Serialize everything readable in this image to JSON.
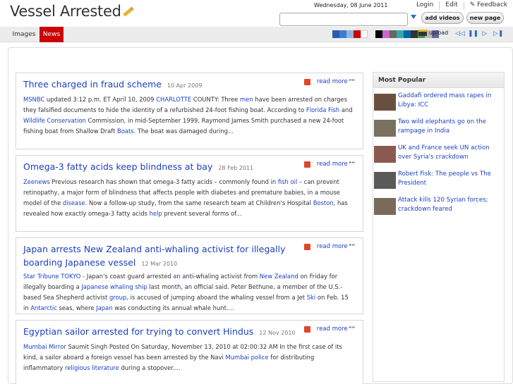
{
  "header": {
    "logo": "Vessel Arrested",
    "date": "Wednesday, 08 June 2011",
    "links": [
      "Login",
      "Edit",
      "Feedback"
    ],
    "search_placeholder": "",
    "add_videos": "add videos",
    "new_page": "new page"
  },
  "nav": {
    "tabs": [
      "Images",
      "News"
    ],
    "active_tab": "News",
    "upload": "upload"
  },
  "colors": {
    "accent": "#cc0000",
    "link": "#1a3fbf",
    "swatches": [
      "#2a5caa",
      "#3a7bd5",
      "#8fb4e0",
      "#cc0000",
      "#ffffff",
      "#000000",
      "#cc66cc",
      "#666666",
      "#33aaaa",
      "#0066aa",
      "#333333",
      "#449944",
      "#bbbbbb",
      "#666699"
    ]
  },
  "articles": [
    {
      "title": "Three charged in fraud scheme",
      "date": "10 Apr 2009",
      "source": "MSNBC",
      "read_more": "read more",
      "body": [
        {
          "t": " updated 3:12 p.m. ET April 10, 2009 "
        },
        {
          "t": "CHARLOTTE",
          "link": true
        },
        {
          "t": " COUNTY: Three "
        },
        {
          "t": "men",
          "link": true
        },
        {
          "t": " have been arrested on charges they falsified documents to hide the identity of a refurbished 24-foot fishing boat. According to "
        },
        {
          "t": "Florida Fish",
          "link": true
        },
        {
          "t": " and "
        },
        {
          "t": "Wildlife Conservation",
          "link": true
        },
        {
          "t": " Commission, in mid-September 1999, Raymond James Smith purchased a new 24-foot fishing boat from Shallow Draft "
        },
        {
          "t": "Boats",
          "link": true
        },
        {
          "t": ". The boat was damaged during..."
        }
      ]
    },
    {
      "title": "Omega-3 fatty acids keep blindness at bay",
      "date": "28 Feb 2011",
      "source": "Zeenews",
      "read_more": "read more",
      "body": [
        {
          "t": " Previous research has shown that omega-3 fatty acids – commonly found in "
        },
        {
          "t": "fish oil",
          "link": true
        },
        {
          "t": " – can prevent retinopathy, a major form of blindness that affects people with diabetes and premature babies, in a mouse model of the "
        },
        {
          "t": "disease",
          "link": true
        },
        {
          "t": ". Now a follow-up study, from the same research team at Children's Hospital "
        },
        {
          "t": "Boston",
          "link": true
        },
        {
          "t": ", has revealed how exactly omega-3 fatty acids "
        },
        {
          "t": "help",
          "link": true
        },
        {
          "t": " prevent several forms of..."
        }
      ]
    },
    {
      "title": "Japan arrests New Zealand anti-whaling activist for illegally boarding Japanese vessel",
      "date": "12 Mar 2010",
      "source": "Star Tribune",
      "read_more": "read more",
      "body": [
        {
          "t": " "
        },
        {
          "t": "TOKYO",
          "link": true
        },
        {
          "t": " - Japan's coast guard arrested "
        },
        {
          "t": "an",
          "link": true
        },
        {
          "t": " anti-whaling activist from "
        },
        {
          "t": "New Zealand",
          "link": true
        },
        {
          "t": " on Friday for illegally boarding a "
        },
        {
          "t": "Japanese whaling ship",
          "link": true
        },
        {
          "t": " last month, an official said. Peter Bethune, a member of the U.S.-based Sea Shepherd activist "
        },
        {
          "t": "group",
          "link": true
        },
        {
          "t": ", is accused of jumping aboard the whaling vessel from a Jet "
        },
        {
          "t": "Ski",
          "link": true
        },
        {
          "t": " on Feb. 15 in "
        },
        {
          "t": "Antarctic",
          "link": true
        },
        {
          "t": " seas, where "
        },
        {
          "t": "Japan",
          "link": true
        },
        {
          "t": " was conducting its annual whale hunt...."
        }
      ]
    },
    {
      "title": "Egyptian sailor arrested for trying to convert Hindus",
      "date": "12 Nov 2010",
      "source": "Mumbai Mirror",
      "read_more": "read more",
      "body": [
        {
          "t": " Saumit Singh Posted On Saturday, November 13, 2010 at 02:00:32 AM In the first case of its kind, a sailor aboard a foreign vessel has been arrested by the Navi "
        },
        {
          "t": "Mumbai police",
          "link": true
        },
        {
          "t": " for distributing inflammatory "
        },
        {
          "t": "religious literature",
          "link": true
        },
        {
          "t": " during a stopover...."
        }
      ]
    }
  ],
  "sidebar": {
    "heading": "Most Popular",
    "items": [
      {
        "text": "Gaddafi ordered mass rapes in Libya: ICC",
        "thumb": "#6b5040"
      },
      {
        "text": "Two wild elephants go on the rampage in India",
        "thumb": "#7a7060"
      },
      {
        "text": "UK and France seek UN action over Syria's crackdown",
        "thumb": "#8a5a50"
      },
      {
        "text": "Robert Fisk: The people vs The President",
        "thumb": "#5a5a5a"
      },
      {
        "text": "Attack kills 120 Syrian forces; crackdown feared",
        "thumb": "#7a6a58"
      }
    ]
  }
}
